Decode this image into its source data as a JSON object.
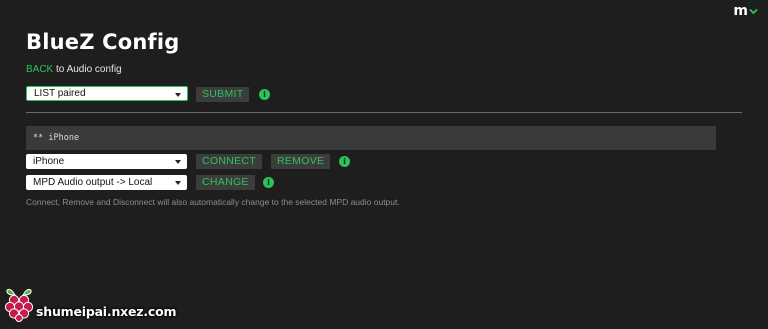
{
  "brand": {
    "logo_letter": "m",
    "logo_icon": "chevron-down-icon",
    "accent_color": "#2bc45c"
  },
  "header": {
    "title": "BlueZ Config",
    "back_link": "BACK",
    "back_suffix": " to Audio config"
  },
  "list_form": {
    "select_value": "LIST paired",
    "submit_label": "SUBMIT",
    "info_icon": "info-icon"
  },
  "device": {
    "header_text": "** iPhone",
    "select_value": "iPhone",
    "connect_label": "CONNECT",
    "remove_label": "REMOVE",
    "output_select_value": "MPD Audio output -> Local",
    "change_label": "CHANGE",
    "help_text": "Connect, Remove and Disconnect will also automatically change to the selected MPD audio output."
  },
  "watermark": {
    "text": "shumeipai.nxez.com",
    "icon": "raspberry-pi-icon"
  }
}
